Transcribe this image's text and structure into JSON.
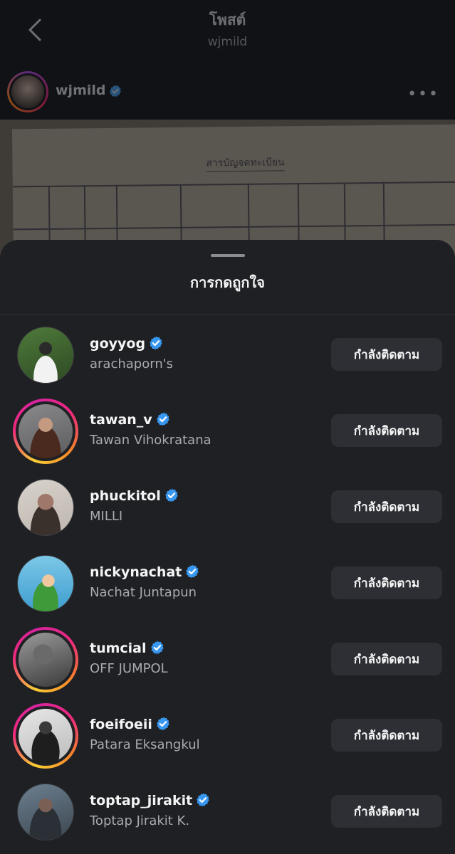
{
  "post_header": {
    "title": "โพสต์",
    "subtitle": "wjmild",
    "username": "wjmild"
  },
  "document": {
    "heading": "สารบัญจดทะเบียน"
  },
  "likes_sheet": {
    "title": "การกดถูกใจ",
    "users": [
      {
        "username": "goyyog",
        "full_name": "arachaporn's",
        "verified": true,
        "has_story": false,
        "button": "กำลังติดตาม"
      },
      {
        "username": "tawan_v",
        "full_name": "Tawan Vihokratana",
        "verified": true,
        "has_story": true,
        "button": "กำลังติดตาม"
      },
      {
        "username": "phuckitol",
        "full_name": "MILLI",
        "verified": true,
        "has_story": false,
        "button": "กำลังติดตาม"
      },
      {
        "username": "nickynachat",
        "full_name": "Nachat Juntapun",
        "verified": true,
        "has_story": false,
        "button": "กำลังติดตาม"
      },
      {
        "username": "tumcial",
        "full_name": "OFF JUMPOL",
        "verified": true,
        "has_story": true,
        "button": "กำลังติดตาม"
      },
      {
        "username": "foeifoeii",
        "full_name": "Patara Eksangkul",
        "verified": true,
        "has_story": true,
        "button": "กำลังติดตาม"
      },
      {
        "username": "toptap_jirakit",
        "full_name": "Toptap Jirakit K.",
        "verified": true,
        "has_story": false,
        "button": "กำลังติดตาม"
      }
    ]
  },
  "colors": {
    "sheet_bg": "#1e2024",
    "button_bg": "#2d2f34",
    "verified_blue": "#3897f0",
    "secondary_text": "#a8aaae"
  }
}
